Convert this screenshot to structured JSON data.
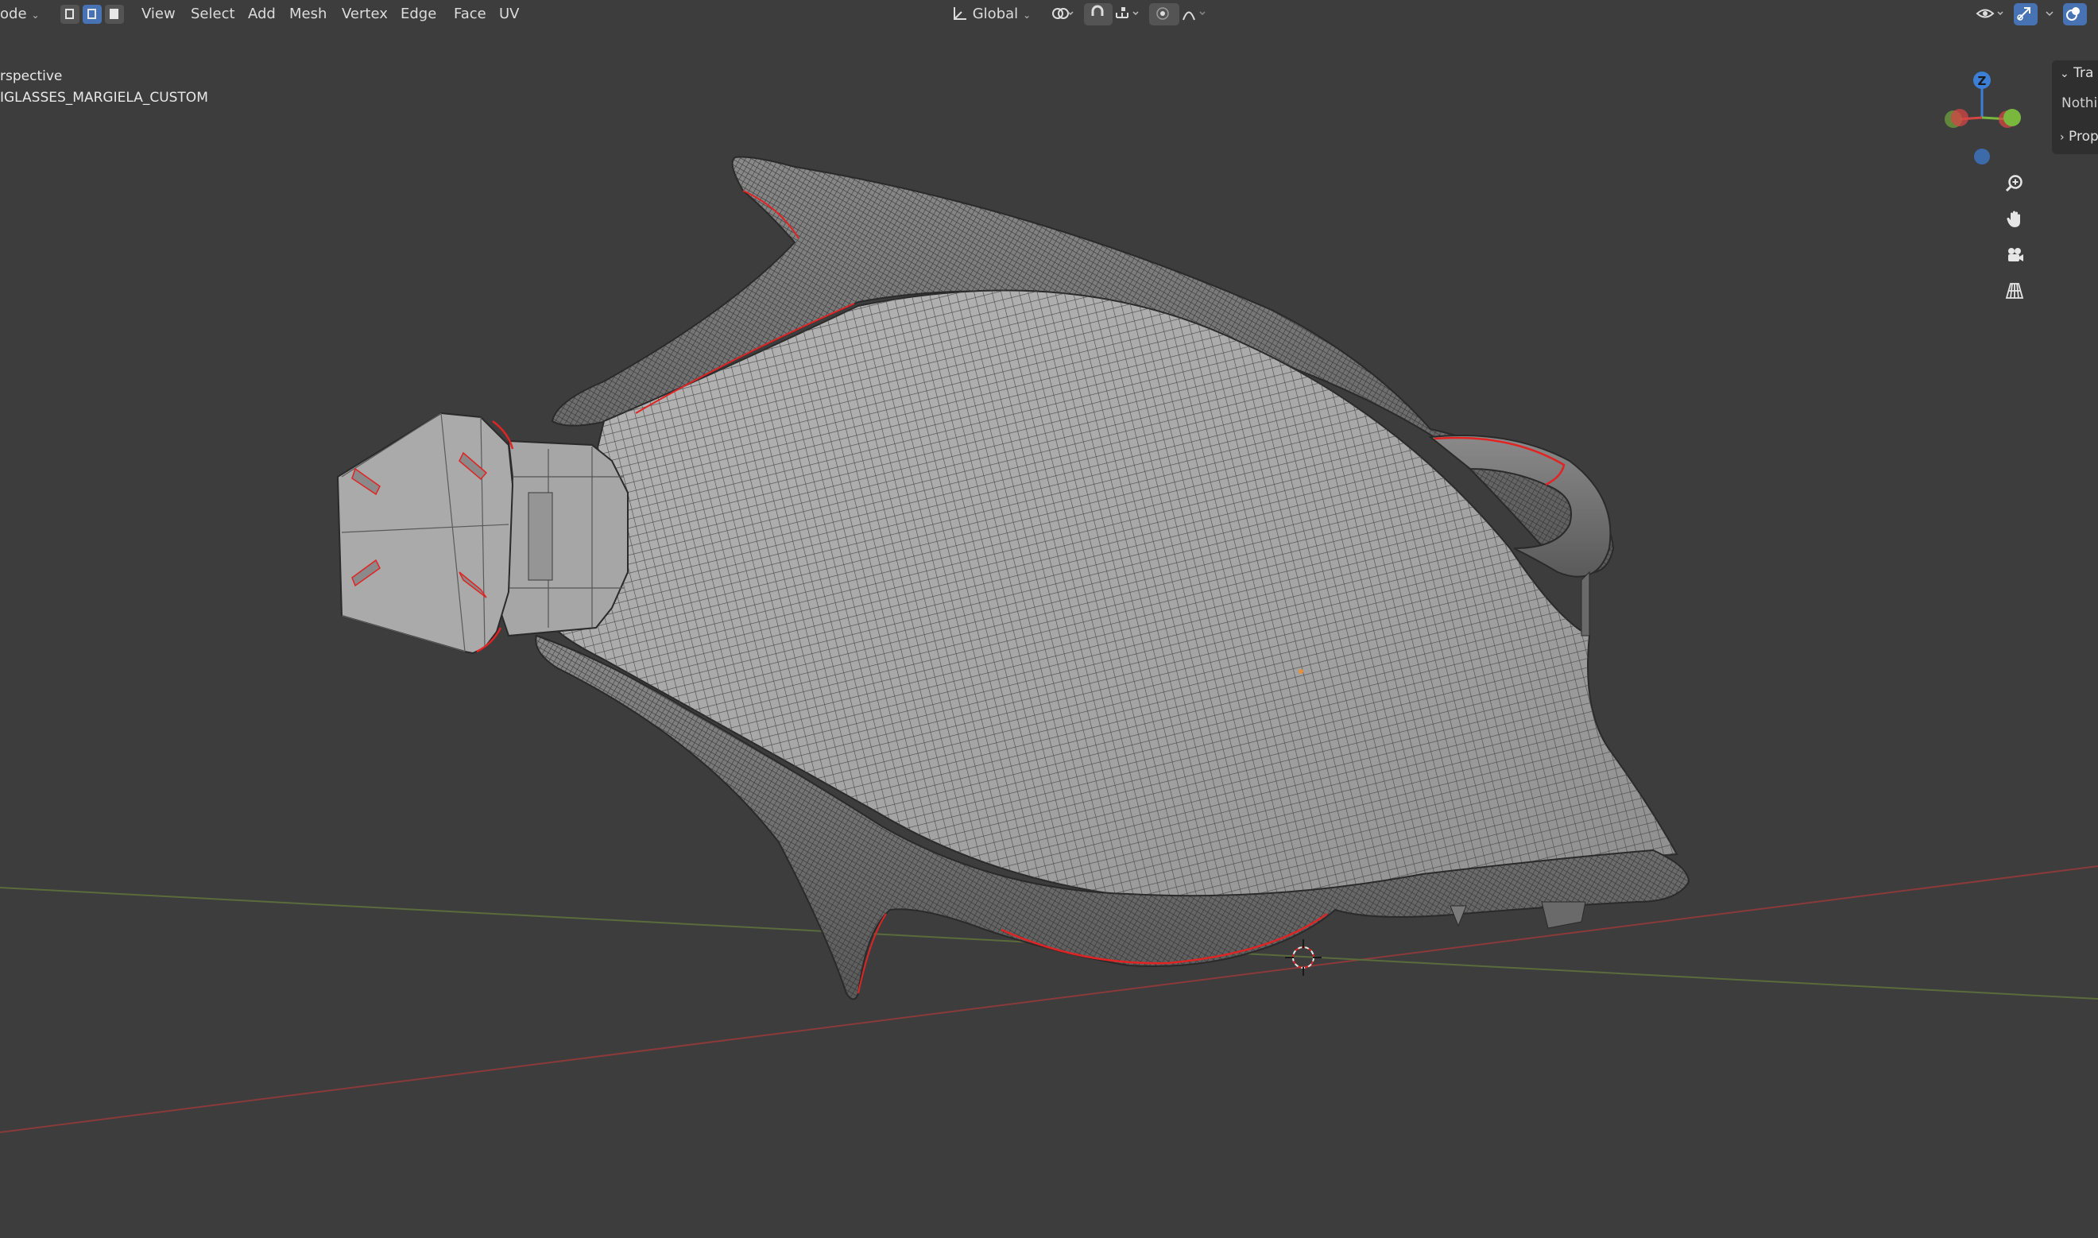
{
  "header": {
    "mode_label": "ode",
    "menus": [
      "View",
      "Select",
      "Add",
      "Mesh",
      "Vertex",
      "Edge",
      "Face",
      "UV"
    ],
    "transform_orientation": "Global"
  },
  "viewport": {
    "view_name": "rspective",
    "object_name": "IGLASSES_MARGIELA_CUSTOM"
  },
  "gizmo": {
    "z_label": "Z",
    "colors": {
      "x": "#d64545",
      "y": "#79b83c",
      "z": "#3d7fd6"
    }
  },
  "side_panel": {
    "transform_label": "Tra",
    "nothing_label": "Nothi",
    "properties_label": "Prop"
  },
  "icons": {
    "header": [
      "select-box-icon",
      "vertex-mode-icon",
      "edge-mode-icon",
      "face-mode-icon",
      "transform-orientation-icon",
      "pivot-icon",
      "snap-icon",
      "snap-target-icon",
      "proportional-edit-icon",
      "falloff-icon",
      "visibility-icon",
      "gizmo-toggle-icon",
      "overlay-icon"
    ],
    "navigation": [
      "zoom-icon",
      "hand-pan-icon",
      "camera-icon",
      "grid-perspective-icon"
    ]
  },
  "colors": {
    "background": "#3d3d3d",
    "accent": "#4772b3",
    "mesh_fill": "#a9a9a9",
    "wire": "#2a2a2a",
    "seam": "#e02424"
  }
}
